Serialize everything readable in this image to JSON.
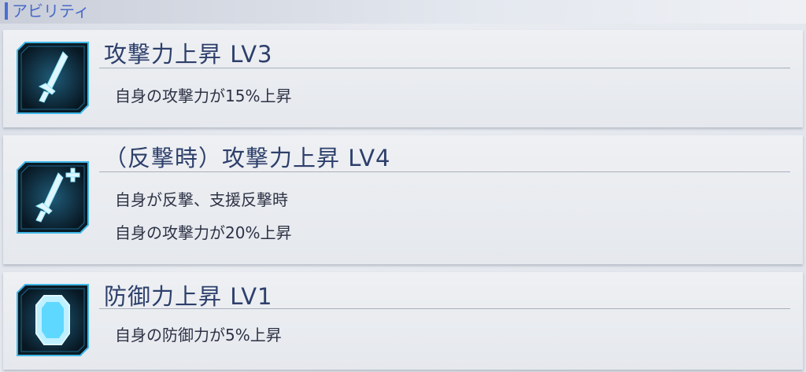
{
  "section": {
    "title": "アビリティ"
  },
  "abilities": [
    {
      "name": "攻撃力上昇 LV3",
      "icon": "sword-icon",
      "desc": [
        "自身の攻撃力が15%上昇"
      ]
    },
    {
      "name": "（反撃時）攻撃力上昇 LV4",
      "icon": "sword-plus-icon",
      "desc": [
        "自身が反撃、支援反撃時",
        "自身の攻撃力が20%上昇"
      ]
    },
    {
      "name": "防御力上昇 LV1",
      "icon": "shield-icon",
      "desc": [
        "自身の防御力が5%上昇"
      ]
    }
  ],
  "colors": {
    "accent": "#4a6fd0",
    "icon_glow": "#5fd8ff",
    "icon_bg": "#0c2433"
  }
}
